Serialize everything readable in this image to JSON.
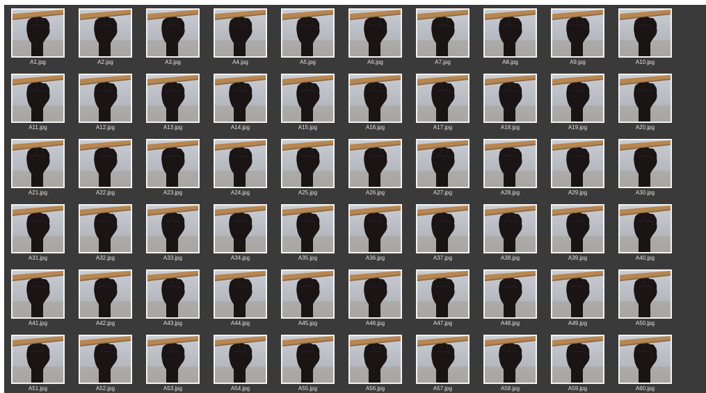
{
  "viewer": {
    "background": "#3a3a3a",
    "thumbnail_border": "#f3f3f3",
    "label_color": "#e3e3e3"
  },
  "files": [
    "A1.jpg",
    "A2.jpg",
    "A3.jpg",
    "A4.jpg",
    "A5.jpg",
    "A6.jpg",
    "A7.jpg",
    "A8.jpg",
    "A9.jpg",
    "A10.jpg",
    "A11.jpg",
    "A12.jpg",
    "A13.jpg",
    "A14.jpg",
    "A15.jpg",
    "A16.jpg",
    "A17.jpg",
    "A18.jpg",
    "A19.jpg",
    "A20.jpg",
    "A21.jpg",
    "A22.jpg",
    "A23.jpg",
    "A24.jpg",
    "A25.jpg",
    "A26.jpg",
    "A27.jpg",
    "A28.jpg",
    "A29.jpg",
    "A30.jpg",
    "A31.jpg",
    "A32.jpg",
    "A33.jpg",
    "A34.jpg",
    "A35.jpg",
    "A36.jpg",
    "A37.jpg",
    "A38.jpg",
    "A39.jpg",
    "A40.jpg",
    "A41.jpg",
    "A42.jpg",
    "A43.jpg",
    "A44.jpg",
    "A45.jpg",
    "A46.jpg",
    "A47.jpg",
    "A48.jpg",
    "A49.jpg",
    "A50.jpg",
    "A51.jpg",
    "A52.jpg",
    "A53.jpg",
    "A54.jpg",
    "A55.jpg",
    "A56.jpg",
    "A57.jpg",
    "A58.jpg",
    "A59.jpg",
    "A60.jpg"
  ],
  "thumbnail_icon": "fist-photo-icon"
}
